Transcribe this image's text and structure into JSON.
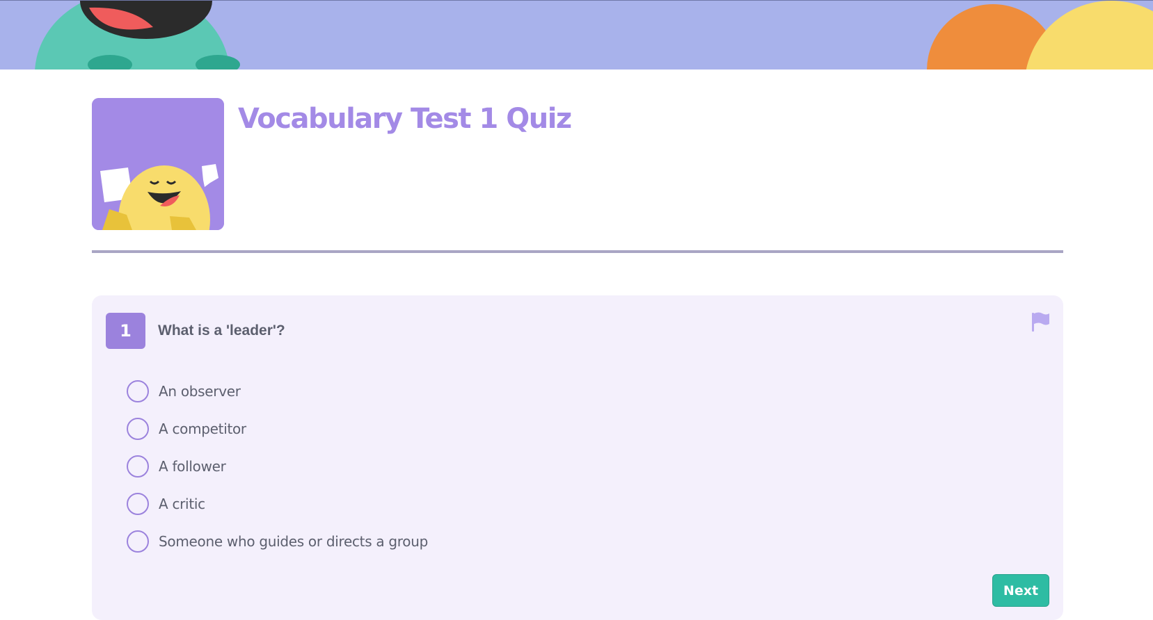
{
  "quiz": {
    "title": "Vocabulary Test 1 Quiz"
  },
  "question": {
    "number": "1",
    "text": "What is a 'leader'?",
    "options": [
      {
        "label": "An observer"
      },
      {
        "label": "A competitor"
      },
      {
        "label": "A follower"
      },
      {
        "label": "A critic"
      },
      {
        "label": "Someone who guides or directs a group"
      }
    ],
    "next_label": "Next"
  },
  "colors": {
    "banner": "#a8b2eb",
    "accent_purple": "#a38ae6",
    "card_bg": "#f4f0fc",
    "next_button": "#2ebca3",
    "text": "#5c5f6e"
  },
  "icons": {
    "flag": "flag-icon",
    "banner_monster": "monster-illustration",
    "banner_suns": "sun-shapes-illustration",
    "thumbnail": "chick-illustration"
  }
}
